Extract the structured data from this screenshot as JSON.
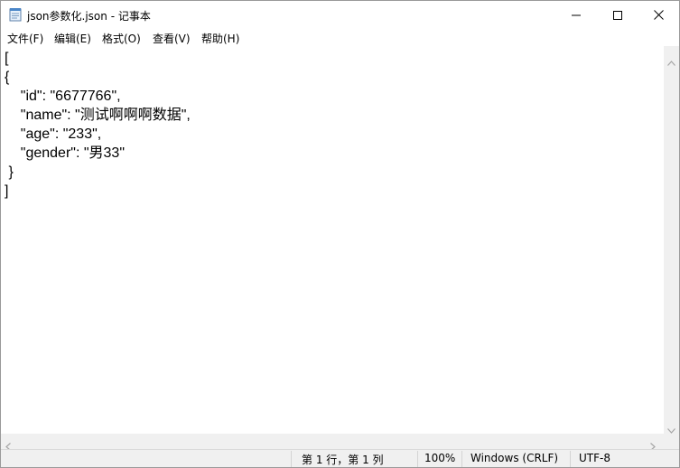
{
  "window": {
    "title": "json参数化.json - 记事本",
    "icon": "notepad-icon"
  },
  "title_buttons": {
    "minimize_icon": "minimize-icon",
    "maximize_icon": "maximize-icon",
    "close_icon": "close-icon"
  },
  "menu": {
    "items": [
      {
        "label": "文件(F)"
      },
      {
        "label": "编辑(E)"
      },
      {
        "label": "格式(O)"
      },
      {
        "label": "查看(V)"
      },
      {
        "label": "帮助(H)"
      }
    ]
  },
  "editor": {
    "lines": [
      "[",
      "{",
      "    \"id\": \"6677766\",",
      "    \"name\": \"测试啊啊啊数据\",",
      "    \"age\": \"233\",",
      "    \"gender\": \"男33\"",
      " }",
      "]"
    ]
  },
  "status": {
    "position": "第 1 行，第 1 列",
    "zoom": "100%",
    "line_ending": "Windows (CRLF)",
    "encoding": "UTF-8"
  }
}
